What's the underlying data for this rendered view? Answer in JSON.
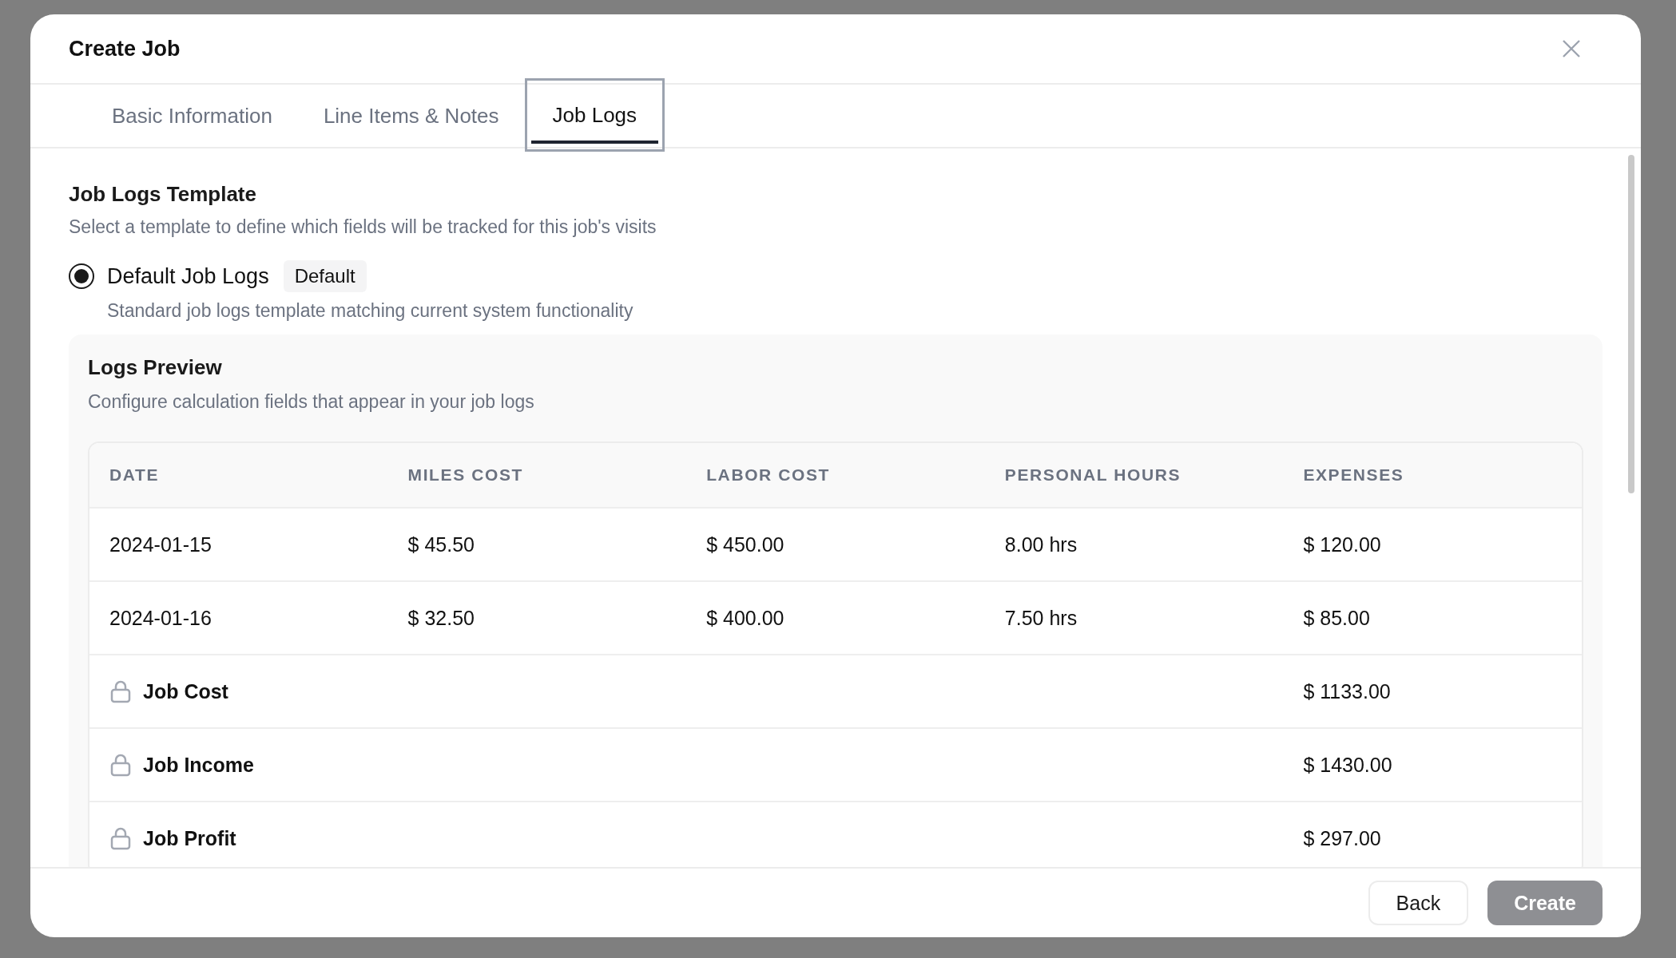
{
  "dialog": {
    "title": "Create Job"
  },
  "tabs": [
    {
      "label": "Basic Information",
      "selected": false
    },
    {
      "label": "Line Items & Notes",
      "selected": false
    },
    {
      "label": "Job Logs",
      "selected": true
    }
  ],
  "template": {
    "heading": "Job Logs Template",
    "description": "Select a template to define which fields will be tracked for this job's visits",
    "options": [
      {
        "label": "Default Job Logs",
        "badge": "Default",
        "description": "Standard job logs template matching current system functionality",
        "selected": true
      }
    ]
  },
  "preview": {
    "title": "Logs Preview",
    "description": "Configure calculation fields that appear in your job logs",
    "table": {
      "columns": [
        "DATE",
        "MILES COST",
        "LABOR COST",
        "PERSONAL HOURS",
        "EXPENSES"
      ],
      "rows": [
        {
          "kind": "data",
          "cells": [
            "2024-01-15",
            "$ 45.50",
            "$ 450.00",
            "8.00 hrs",
            "$ 120.00"
          ]
        },
        {
          "kind": "data",
          "cells": [
            "2024-01-16",
            "$ 32.50",
            "$ 400.00",
            "7.50 hrs",
            "$ 85.00"
          ]
        },
        {
          "kind": "total",
          "label": "Job Cost",
          "value": "$ 1133.00"
        },
        {
          "kind": "total",
          "label": "Job Income",
          "value": "$ 1430.00"
        },
        {
          "kind": "total",
          "label": "Job Profit",
          "value": "$ 297.00"
        }
      ]
    }
  },
  "footer": {
    "buttons": [
      {
        "label": "Back",
        "kind": "secondary",
        "disabled": false
      },
      {
        "label": "Create",
        "kind": "primary",
        "disabled": true
      }
    ]
  }
}
